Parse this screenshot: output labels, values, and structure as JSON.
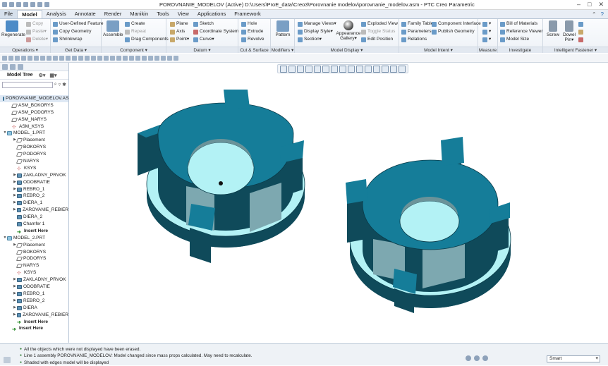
{
  "title": "POROVNANIE_MODELOV (Active) D:\\Users\\ProE_data\\Creo3\\Porovnanie modelov\\porovnanie_modelov.asm - PTC Creo Parametric",
  "tabs": [
    "File",
    "Model",
    "Analysis",
    "Annotate",
    "Render",
    "Manikin",
    "Tools",
    "View",
    "Applications",
    "Framework"
  ],
  "active_tab": "Model",
  "ribbon": {
    "operations": {
      "label": "Operations",
      "regenerate": "Regenerate",
      "copy": "Copy",
      "paste": "Paste",
      "delete": "Delete"
    },
    "getdata": {
      "label": "Get Data",
      "udf": "User-Defined Feature",
      "copygeom": "Copy Geometry",
      "shrinkwrap": "Shrinkwrap"
    },
    "component": {
      "label": "Component",
      "assemble": "Assemble",
      "create": "Create",
      "repeat": "Repeat",
      "drag": "Drag Components"
    },
    "datum": {
      "label": "Datum",
      "plane": "Plane",
      "axis": "Axis",
      "point": "Point",
      "sketch": "Sketch",
      "csys": "Coordinate System",
      "curve": "Curve"
    },
    "cutsurface": {
      "label": "Cut & Surface",
      "hole": "Hole",
      "extrude": "Extrude",
      "revolve": "Revolve"
    },
    "modifiers": {
      "label": "Modifiers",
      "pattern": "Pattern"
    },
    "modeldisplay": {
      "label": "Model Display",
      "manage": "Manage Views",
      "style": "Display Style",
      "section": "Section",
      "appearance": "Appearance",
      "gallery": "Gallery",
      "exploded": "Exploded View",
      "toggle": "Toggle Status",
      "editpos": "Edit Position"
    },
    "modelintent": {
      "label": "Model Intent",
      "family": "Family Table",
      "params": "Parameters",
      "relations": "Relations",
      "compiface": "Component Interface",
      "publish": "Publish Geometry"
    },
    "measure": {
      "label": "Measure"
    },
    "investigate": {
      "label": "Investigate",
      "bom": "Bill of Materials",
      "refviewer": "Reference Viewer",
      "modelsize": "Model Size"
    },
    "fastener": {
      "label": "Intelligent Fastener",
      "screw": "Screw",
      "dowel": "Dowel",
      "pin": "Pin"
    }
  },
  "tree": {
    "header": "Model Tree",
    "items": [
      {
        "label": "POROVNANIE_MODELOV.ASM",
        "indent": 0,
        "exp": "",
        "icon": "asm",
        "sel": true
      },
      {
        "label": "ASM_BOKORYS",
        "indent": 1,
        "exp": "",
        "icon": "plane"
      },
      {
        "label": "ASM_PODORYS",
        "indent": 1,
        "exp": "",
        "icon": "plane"
      },
      {
        "label": "ASM_NARYS",
        "indent": 1,
        "exp": "",
        "icon": "plane"
      },
      {
        "label": "ASM_KSYS",
        "indent": 1,
        "exp": "",
        "icon": "csys"
      },
      {
        "label": "MODEL_1.PRT",
        "indent": 0,
        "exp": "▼",
        "icon": "part"
      },
      {
        "label": "Placement",
        "indent": 2,
        "exp": "▶",
        "icon": "plane"
      },
      {
        "label": "BOKORYS",
        "indent": 2,
        "exp": "",
        "icon": "plane"
      },
      {
        "label": "PODORYS",
        "indent": 2,
        "exp": "",
        "icon": "plane"
      },
      {
        "label": "NARYS",
        "indent": 2,
        "exp": "",
        "icon": "plane"
      },
      {
        "label": "KSYS",
        "indent": 2,
        "exp": "",
        "icon": "csys"
      },
      {
        "label": "ZAKLADNY_PRVOK",
        "indent": 2,
        "exp": "▶",
        "icon": "feat"
      },
      {
        "label": "ODOBRATIE",
        "indent": 2,
        "exp": "▶",
        "icon": "feat"
      },
      {
        "label": "REBRO_1",
        "indent": 2,
        "exp": "▶",
        "icon": "feat"
      },
      {
        "label": "REBRO_2",
        "indent": 2,
        "exp": "▶",
        "icon": "feat"
      },
      {
        "label": "DIERA_1",
        "indent": 2,
        "exp": "▶",
        "icon": "feat"
      },
      {
        "label": "ZAROVANIE_REBIER",
        "indent": 2,
        "exp": "▶",
        "icon": "feat"
      },
      {
        "label": "DIERA_2",
        "indent": 2,
        "exp": "",
        "icon": "feat"
      },
      {
        "label": "Chamfer 1",
        "indent": 2,
        "exp": "",
        "icon": "feat"
      },
      {
        "label": "Insert Here",
        "indent": 2,
        "exp": "",
        "icon": "ins",
        "bold": true
      },
      {
        "label": "MODEL_2.PRT",
        "indent": 0,
        "exp": "▼",
        "icon": "part"
      },
      {
        "label": "Placement",
        "indent": 2,
        "exp": "▶",
        "icon": "plane"
      },
      {
        "label": "BOKORYS",
        "indent": 2,
        "exp": "",
        "icon": "plane"
      },
      {
        "label": "PODORYS",
        "indent": 2,
        "exp": "",
        "icon": "plane"
      },
      {
        "label": "NARYS",
        "indent": 2,
        "exp": "",
        "icon": "plane"
      },
      {
        "label": "KSYS",
        "indent": 2,
        "exp": "",
        "icon": "csys"
      },
      {
        "label": "ZAKLADNY_PRVOK",
        "indent": 2,
        "exp": "▶",
        "icon": "feat"
      },
      {
        "label": "ODOBRATIE",
        "indent": 2,
        "exp": "▶",
        "icon": "feat"
      },
      {
        "label": "REBRO_1",
        "indent": 2,
        "exp": "▶",
        "icon": "feat"
      },
      {
        "label": "REBRO_2",
        "indent": 2,
        "exp": "▶",
        "icon": "feat"
      },
      {
        "label": "DIERA",
        "indent": 2,
        "exp": "▶",
        "icon": "feat"
      },
      {
        "label": "ZAROVANIE_REBIER",
        "indent": 2,
        "exp": "▶",
        "icon": "feat"
      },
      {
        "label": "Insert Here",
        "indent": 2,
        "exp": "",
        "icon": "ins",
        "bold": true
      },
      {
        "label": "Insert Here",
        "indent": 1,
        "exp": "",
        "icon": "ins",
        "bold": true
      }
    ]
  },
  "messages": [
    "All the objects which were not displayed have been erased.",
    "Line 1 assembly POROVNANIE_MODELOV: Model changed since mass props calculated. May need to recalculate.",
    "Shaded with edges model will be displayed"
  ],
  "selection_filter": "Smart",
  "colors": {
    "part_top": "#157d99",
    "part_side": "#0f4a5a",
    "part_light": "#b3f2f5",
    "part_inner": "#7da8b0"
  }
}
